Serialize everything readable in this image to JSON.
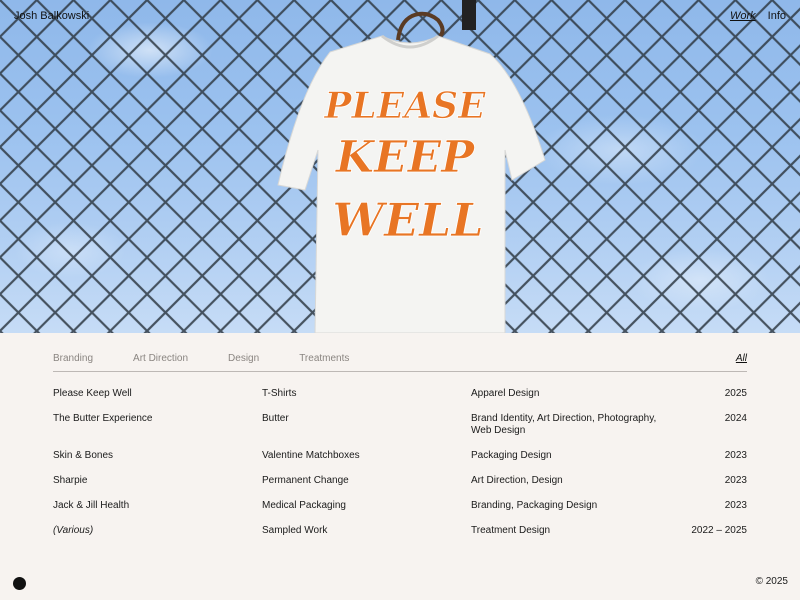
{
  "header": {
    "site_name": "Josh Balkowski",
    "nav": [
      {
        "label": "Work",
        "active": true
      },
      {
        "label": "Info",
        "active": false
      }
    ]
  },
  "hero": {
    "image_alt": "White t-shirt with orange blackletter print on a chain-link fence",
    "shirt_text": [
      "PLEASE",
      "KEEP",
      "WELL"
    ],
    "colors": {
      "sky": "#9cc2ef",
      "print": "#e87524",
      "shirt": "#f4f4f2"
    }
  },
  "filters": {
    "tabs": [
      "Branding",
      "Art Direction",
      "Design",
      "Treatments"
    ],
    "all_label": "All"
  },
  "projects": [
    {
      "name": "Please Keep Well",
      "client": "T-Shirts",
      "type": "Apparel Design",
      "year": "2025"
    },
    {
      "name": "The Butter Experience",
      "client": "Butter",
      "type": "Brand Identity, Art Direction, Photography, Web Design",
      "year": "2024"
    },
    {
      "name": "Skin & Bones",
      "client": "Valentine Matchboxes",
      "type": "Packaging Design",
      "year": "2023"
    },
    {
      "name": "Sharpie",
      "client": "Permanent Change",
      "type": "Art Direction, Design",
      "year": "2023"
    },
    {
      "name": "Jack & Jill Health",
      "client": "Medical Packaging",
      "type": "Branding, Packaging Design",
      "year": "2023"
    },
    {
      "name": "(Various)",
      "client": "Sampled Work",
      "type": "Treatment Design",
      "year": "2022 – 2025"
    }
  ],
  "footer": {
    "copyright": "© 2025"
  }
}
